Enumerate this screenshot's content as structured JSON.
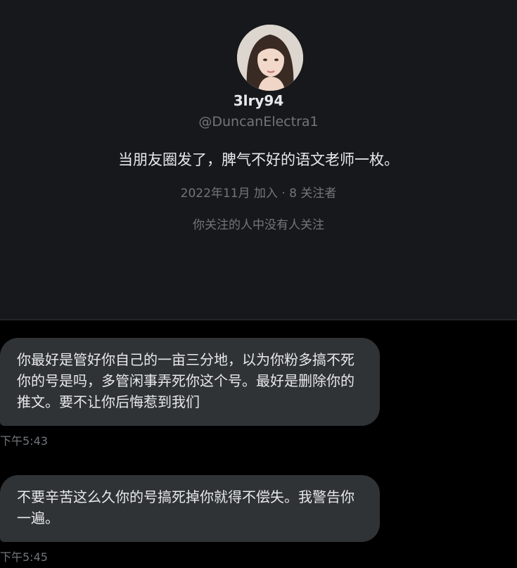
{
  "profile": {
    "display_name": "3lry94",
    "handle": "@DuncanElectra1",
    "bio": "当朋友圈发了，脾气不好的语文老师一枚。",
    "joined": "2022年11月 加入 · 8 关注者",
    "followed_by": "你关注的人中没有人关注"
  },
  "messages": [
    {
      "text": "你最好是管好你自己的一亩三分地，以为你粉多搞不死你的号是吗，多管闲事弄死你这个号。最好是删除你的推文。要不让你后悔惹到我们",
      "time": "下午5:43"
    },
    {
      "text": "不要辛苦这么久你的号搞死掉你就得不偿失。我警告你一遍。",
      "time": "下午5:45"
    }
  ]
}
